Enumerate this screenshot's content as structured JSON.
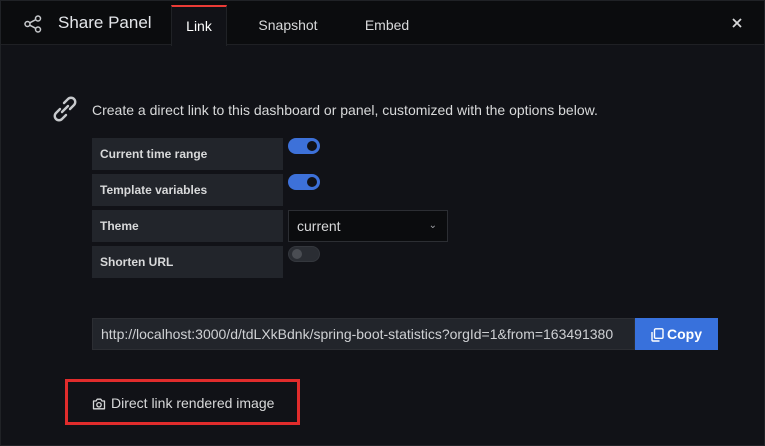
{
  "header": {
    "title": "Share Panel",
    "icon": "share-icon",
    "close_icon": "close-icon"
  },
  "tabs": [
    {
      "label": "Link",
      "active": true
    },
    {
      "label": "Snapshot",
      "active": false
    },
    {
      "label": "Embed",
      "active": false
    }
  ],
  "link_tab": {
    "icon": "link-icon",
    "intro": "Create a direct link to this dashboard or panel, customized with the options below.",
    "options": {
      "current_time_range": {
        "label": "Current time range",
        "enabled": true
      },
      "template_variables": {
        "label": "Template variables",
        "enabled": true
      },
      "theme": {
        "label": "Theme",
        "value": "current"
      },
      "shorten_url": {
        "label": "Shorten URL",
        "enabled": false
      }
    },
    "url": "http://localhost:3000/d/tdLXkBdnk/spring-boot-statistics?orgId=1&from=163491380",
    "copy_label": "Copy",
    "rendered_image_label": "Direct link rendered image"
  },
  "colors": {
    "accent": "#3871dc",
    "active_tab": "#eb3b36",
    "highlight": "#e12c2c",
    "background": "#111217"
  }
}
